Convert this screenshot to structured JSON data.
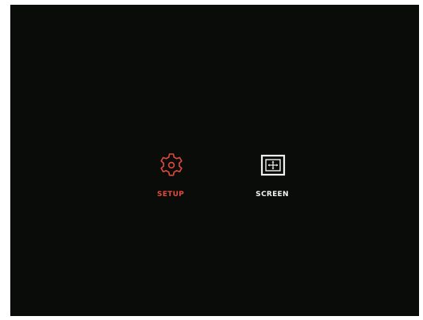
{
  "menu": {
    "items": [
      {
        "label": "SETUP",
        "icon": "gear-icon",
        "selected": true,
        "color": "#e04a3a"
      },
      {
        "label": "SCREEN",
        "icon": "screen-icon",
        "selected": false,
        "color": "#f2f2f2"
      }
    ]
  },
  "colors": {
    "background": "#0a0c0a",
    "accent": "#e04a3a",
    "text": "#f2f2f2"
  }
}
